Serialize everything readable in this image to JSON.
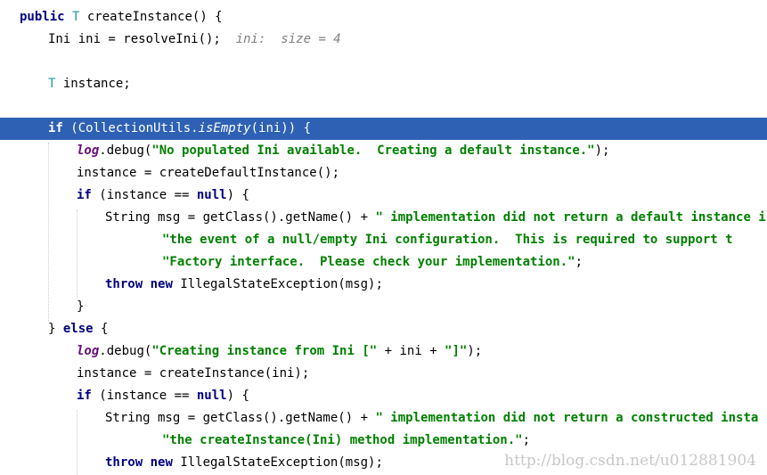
{
  "code": {
    "line1": {
      "kw": "public",
      "type": "T",
      "rest": " createInstance() {"
    },
    "line2": {
      "code": "Ini ini = resolveIni();",
      "hint": "ini:  size = 4"
    },
    "line3": {
      "type": "T",
      "rest": " instance;"
    },
    "line4": {
      "kw": "if",
      "pre": " (CollectionUtils.",
      "method": "isEmpty",
      "post": "(ini)) {"
    },
    "line5": {
      "field": "log",
      "pre": ".debug(",
      "str": "\"No populated Ini available.  Creating a default instance.\"",
      "post": ");"
    },
    "line6": {
      "code": "instance = createDefaultInstance();"
    },
    "line7": {
      "kw": "if",
      "pre": " (instance == ",
      "kw2": "null",
      "post": ") {"
    },
    "line8": {
      "pre": "String msg = getClass().getName() + ",
      "str": "\" implementation did not return a default instance i"
    },
    "line9": {
      "str": "\"the event of a null/empty Ini configuration.  This is required to support t"
    },
    "line10": {
      "str": "\"Factory interface.  Please check your implementation.\"",
      "post": ";"
    },
    "line11": {
      "kw": "throw",
      "kw2": "new",
      "post": "IllegalStateException(msg);"
    },
    "line12": {
      "text": "}"
    },
    "line13": {
      "brace": "} ",
      "kw": "else",
      "post": " {"
    },
    "line14": {
      "field": "log",
      "pre": ".debug(",
      "str1": "\"Creating instance from Ini [\"",
      "mid": " + ini + ",
      "str2": "\"]\"",
      "post": ");"
    },
    "line15": {
      "code": "instance = createInstance(ini);"
    },
    "line16": {
      "kw": "if",
      "pre": " (instance == ",
      "kw2": "null",
      "post": ") {"
    },
    "line17": {
      "pre": "String msg = getClass().getName() + ",
      "str": "\" implementation did not return a constructed insta"
    },
    "line18": {
      "str": "\"the createInstance(Ini) method implementation.\"",
      "post": ";"
    },
    "line19": {
      "kw": "throw",
      "kw2": "new",
      "post": "IllegalStateException(msg);"
    }
  },
  "watermark": "http://blog.csdn.net/u012881904",
  "colors": {
    "keyword": "#000080",
    "type": "#20999d",
    "string": "#008000",
    "hint": "#808080",
    "field": "#660e7a",
    "current_line": "#2e61b3"
  }
}
